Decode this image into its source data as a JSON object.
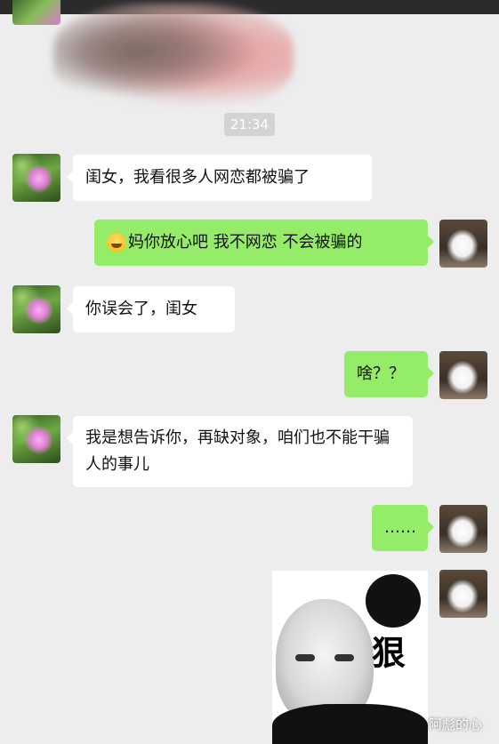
{
  "status_bar": {
    "background": "#2b2b2b"
  },
  "timestamp": "21:34",
  "colors": {
    "background": "#ededed",
    "bubble_self": "#95ec69",
    "bubble_other": "#ffffff",
    "timestamp_bg": "#d3d3d3"
  },
  "messages": [
    {
      "sender": "other",
      "avatar": "pink-flower-avatar",
      "text": "闺女，我看很多人网恋都被骗了"
    },
    {
      "sender": "self",
      "avatar": "husky-dog-avatar",
      "emoji": "laughing-face-emoji",
      "text": "妈你放心吧 我不网恋 不会被骗的"
    },
    {
      "sender": "other",
      "avatar": "pink-flower-avatar",
      "text": "你误会了，闺女"
    },
    {
      "sender": "self",
      "avatar": "husky-dog-avatar",
      "text": "啥？？"
    },
    {
      "sender": "other",
      "avatar": "pink-flower-avatar",
      "text": "我是想告诉你，再缺对象，咱们也不能干骗人的事儿"
    },
    {
      "sender": "self",
      "avatar": "husky-dog-avatar",
      "text": "……"
    },
    {
      "sender": "self",
      "avatar": "husky-dog-avatar",
      "type": "sticker",
      "sticker_text": "狠"
    }
  ],
  "watermark": "阿彪的心"
}
